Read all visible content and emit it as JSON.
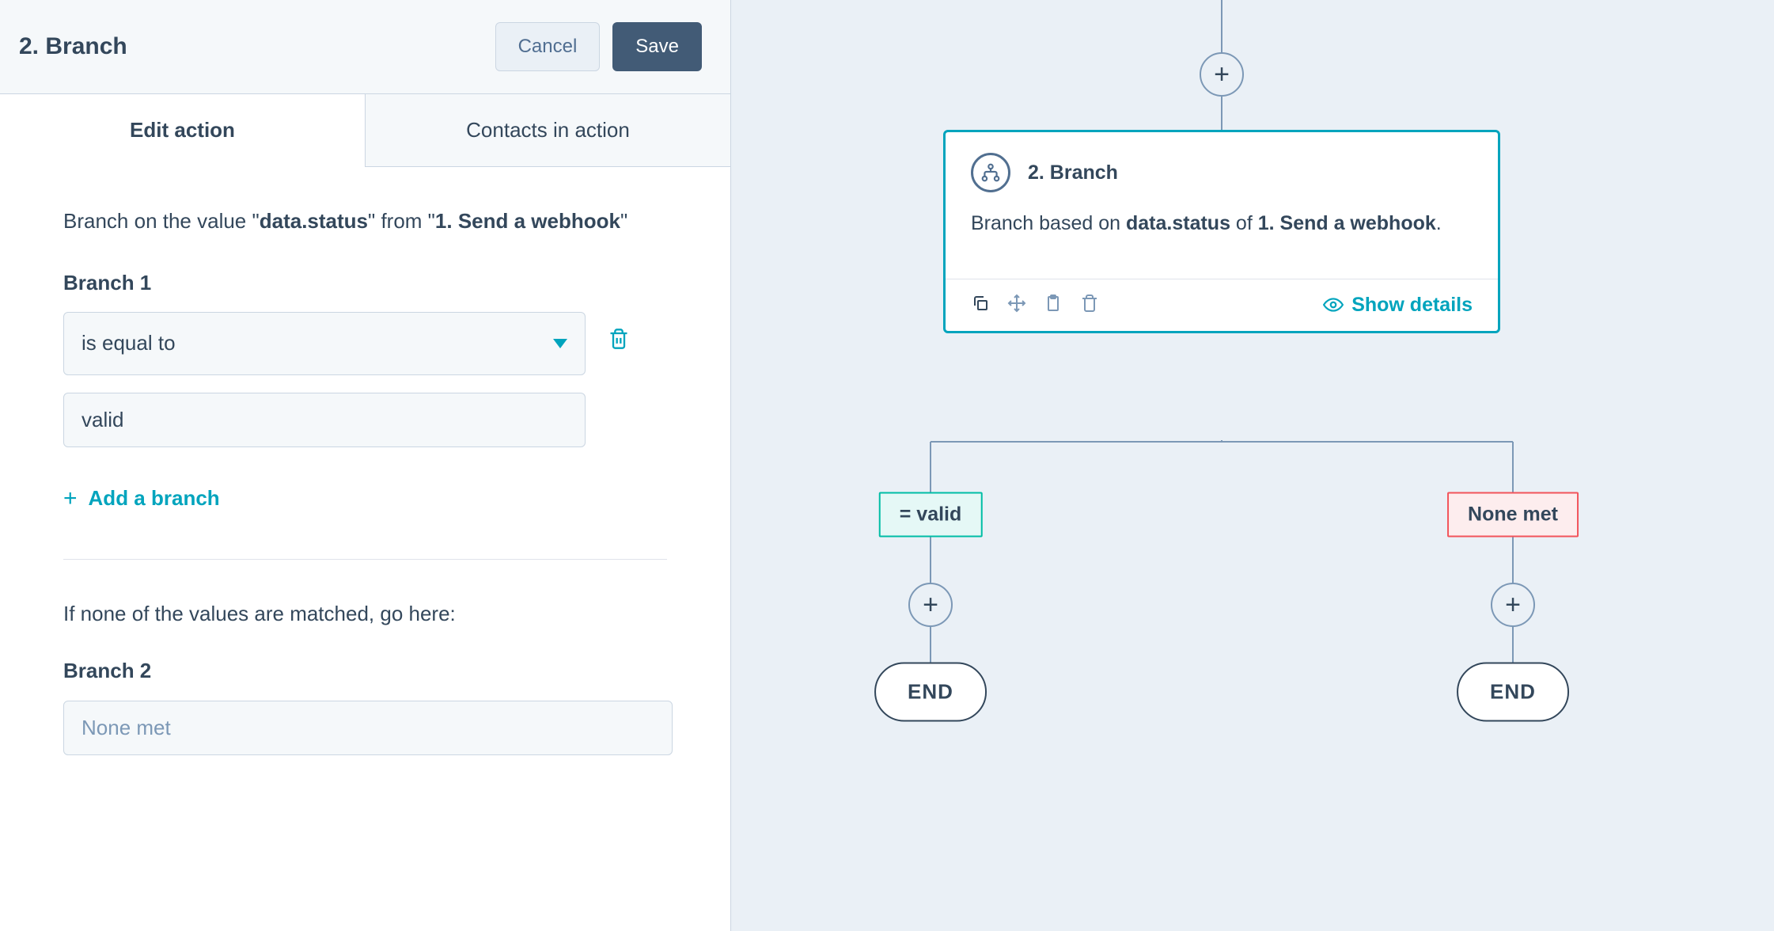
{
  "panel": {
    "title": "2. Branch",
    "cancel": "Cancel",
    "save": "Save",
    "tabs": {
      "edit": "Edit action",
      "contacts": "Contacts in action"
    },
    "desc_pre": "Branch on the value \"",
    "desc_field": "data.status",
    "desc_mid": "\" from \"",
    "desc_source": "1. Send a webhook",
    "desc_post": "\"",
    "branch1_label": "Branch 1",
    "operator": "is equal to",
    "value": "valid",
    "add_branch": "Add a branch",
    "none_text": "If none of the values are matched, go here:",
    "branch2_label": "Branch 2",
    "branch2_placeholder": "None met"
  },
  "card": {
    "title": "2. Branch",
    "body_pre": "Branch based on ",
    "body_field": "data.status",
    "body_mid": " of ",
    "body_source": "1. Send a webhook",
    "body_post": ".",
    "show_details": "Show details"
  },
  "flow": {
    "label_valid": "= valid",
    "label_none": "None met",
    "end": "END",
    "plus": "+"
  }
}
